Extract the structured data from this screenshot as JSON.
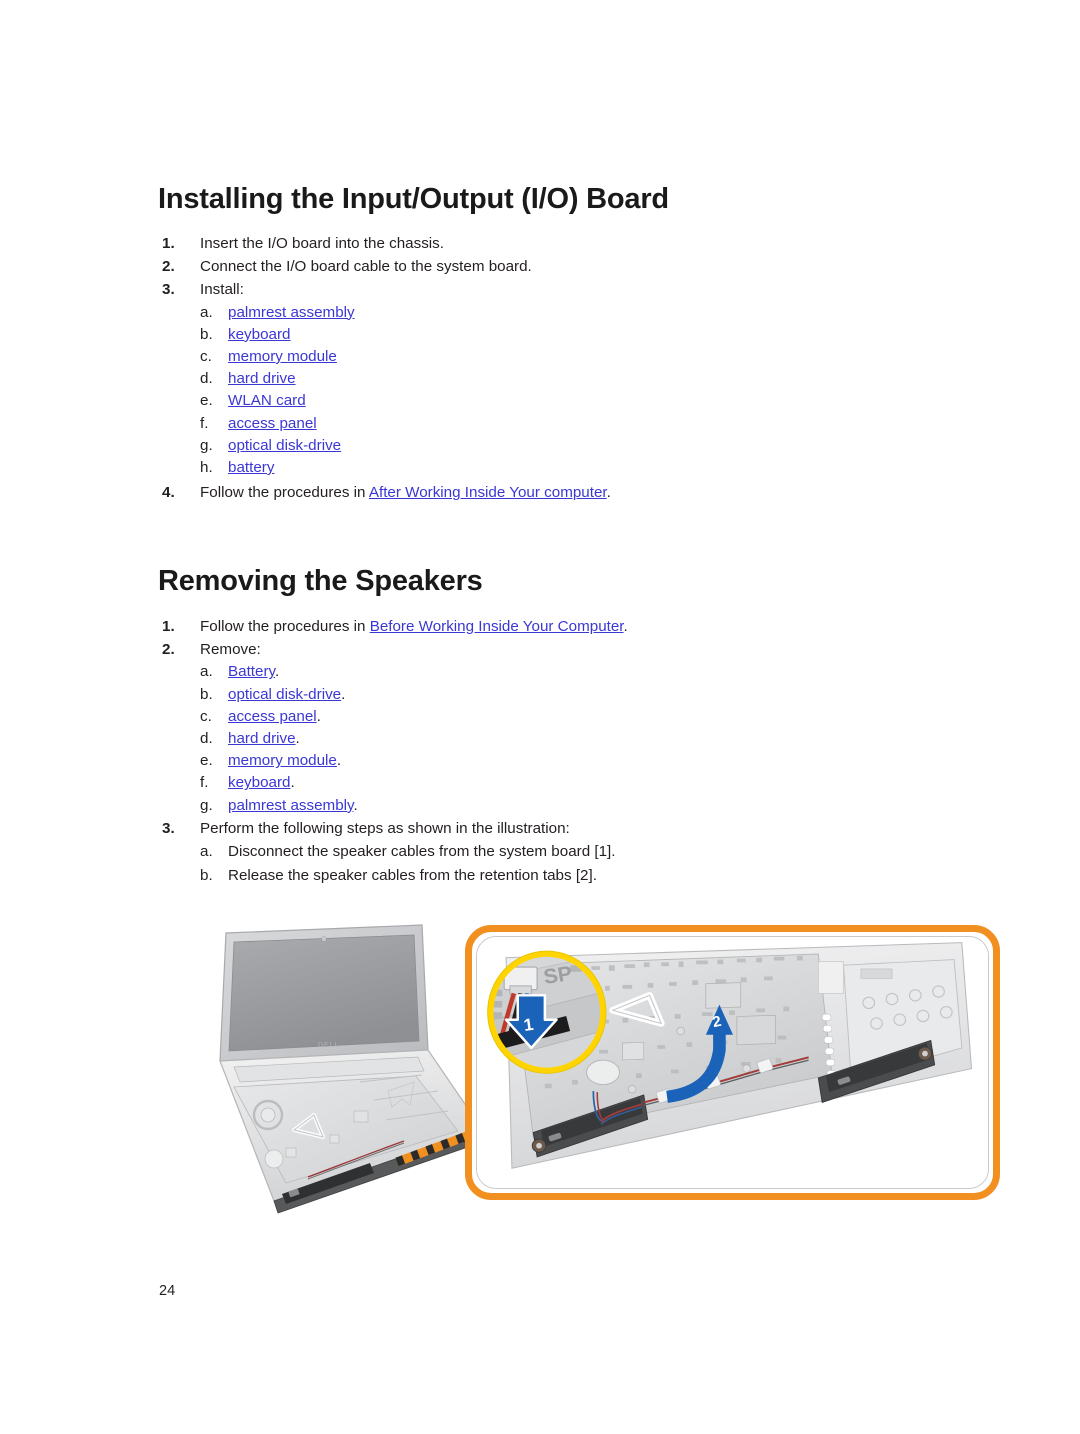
{
  "document": {
    "page_number": "24"
  },
  "sections": [
    {
      "id": "installing-io-board",
      "heading": "Installing the Input/Output (I/O) Board",
      "steps": [
        {
          "num": "1.",
          "text": "Insert the I/O board into the chassis."
        },
        {
          "num": "2.",
          "text": "Connect the I/O board cable to the system board."
        },
        {
          "num": "3.",
          "text": "Install:"
        }
      ],
      "install_items": [
        {
          "letter": "a.",
          "link": "palmrest assembly",
          "tail": ""
        },
        {
          "letter": "b.",
          "link": "keyboard",
          "tail": ""
        },
        {
          "letter": "c.",
          "link": "memory module",
          "tail": ""
        },
        {
          "letter": "d.",
          "link": "hard drive",
          "tail": ""
        },
        {
          "letter": "e.",
          "link": "WLAN card",
          "tail": ""
        },
        {
          "letter": "f.",
          "link": "access panel",
          "tail": ""
        },
        {
          "letter": "g.",
          "link": "optical disk-drive",
          "tail": ""
        },
        {
          "letter": "h.",
          "link": "battery",
          "tail": ""
        }
      ],
      "final_step": {
        "num": "4.",
        "lead": "Follow the procedures in ",
        "link": "After Working Inside Your computer",
        "tail": "."
      }
    },
    {
      "id": "removing-speakers",
      "heading": "Removing the Speakers",
      "step1": {
        "num": "1.",
        "lead": "Follow the procedures in ",
        "link": "Before Working Inside Your Computer",
        "tail": "."
      },
      "step2": {
        "num": "2.",
        "text": "Remove:"
      },
      "remove_items": [
        {
          "letter": "a.",
          "link": "Battery",
          "tail": "."
        },
        {
          "letter": "b.",
          "link": "optical disk-drive",
          "tail": "."
        },
        {
          "letter": "c.",
          "link": "access panel",
          "tail": "."
        },
        {
          "letter": "d.",
          "link": "hard drive",
          "tail": "."
        },
        {
          "letter": "e.",
          "link": "memory module",
          "tail": "."
        },
        {
          "letter": "f.",
          "link": "keyboard",
          "tail": "."
        },
        {
          "letter": "g.",
          "link": "palmrest assembly",
          "tail": "."
        }
      ],
      "step3": {
        "num": "3.",
        "text": "Perform the following steps as shown in the illustration:"
      },
      "illustration_steps": [
        {
          "letter": "a.",
          "text": "Disconnect the speaker cables from the system board [1]."
        },
        {
          "letter": "b.",
          "text": "Release the speaker cables from the retention tabs [2]."
        }
      ]
    }
  ],
  "figure": {
    "callout_1": "1",
    "callout_2": "2",
    "connector_label": "SP",
    "colors": {
      "panel_border": "#f18f20",
      "magnifier_ring": "#ffd400",
      "arrow_blue": "#1a63b8",
      "link": "#3b37d4"
    }
  }
}
